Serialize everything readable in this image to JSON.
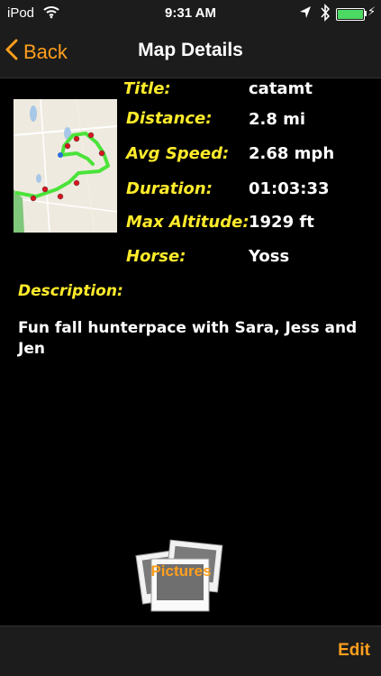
{
  "status_bar": {
    "carrier": "iPod",
    "time": "9:31 AM",
    "battery_color": "#4cd964"
  },
  "nav": {
    "back_label": "Back",
    "title": "Map Details"
  },
  "details": {
    "title_label": "Title:",
    "title_value": "catamt",
    "distance_label": "Distance:",
    "distance_value": "2.8 mi",
    "avg_speed_label": "Avg Speed:",
    "avg_speed_value": "2.68 mph",
    "duration_label": "Duration:",
    "duration_value": "01:03:33",
    "max_altitude_label": "Max Altitude:",
    "max_altitude_value": "1929 ft",
    "horse_label": "Horse:",
    "horse_value": "Yoss"
  },
  "description": {
    "label": "Description:",
    "text": "Fun fall hunterpace with Sara, Jess and Jen"
  },
  "pictures": {
    "label": "Pictures"
  },
  "toolbar": {
    "edit_label": "Edit"
  },
  "colors": {
    "accent": "#ff9f1c",
    "label_yellow": "#ffeb2b",
    "route_green": "#4be33a",
    "pin_red": "#d9141e"
  },
  "icons": {
    "wifi": "wifi-icon",
    "location": "location-arrow-icon",
    "bluetooth": "bluetooth-icon",
    "battery": "battery-icon",
    "back_chevron": "chevron-left-icon",
    "pictures": "photos-stack-icon"
  }
}
